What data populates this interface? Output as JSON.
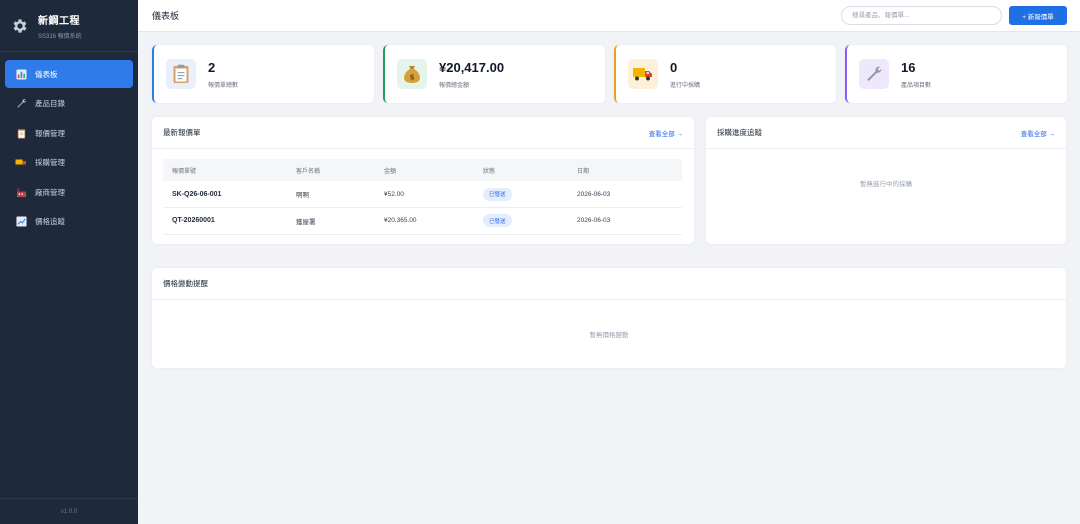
{
  "brand": {
    "title": "新鋼工程",
    "subtitle": "SS316 報價系統",
    "version": "v1.0.0"
  },
  "nav": [
    {
      "label": "儀表板",
      "icon": "chart-icon",
      "active": true
    },
    {
      "label": "產品目錄",
      "icon": "wrench-icon",
      "active": false
    },
    {
      "label": "報價管理",
      "icon": "clipboard-icon",
      "active": false
    },
    {
      "label": "採購管理",
      "icon": "truck-icon",
      "active": false
    },
    {
      "label": "廠商管理",
      "icon": "factory-icon",
      "active": false
    },
    {
      "label": "價格追蹤",
      "icon": "trend-icon",
      "active": false
    }
  ],
  "topbar": {
    "title": "儀表板",
    "search_placeholder": "搜尋產品、報價單...",
    "new_button": "+ 新報價單"
  },
  "stats": [
    {
      "value": "2",
      "label": "報價單總數",
      "accent": "#2f7bea",
      "icon": "clipboard-icon"
    },
    {
      "value": "¥20,417.00",
      "label": "報價總金額",
      "accent": "#22a05b",
      "icon": "money-bag-icon"
    },
    {
      "value": "0",
      "label": "進行中採購",
      "accent": "#f0a020",
      "icon": "truck-icon"
    },
    {
      "value": "16",
      "label": "產品項目數",
      "accent": "#8b5cf6",
      "icon": "wrench-icon"
    }
  ],
  "quotes": {
    "title": "最新報價單",
    "view_all": "查看全部 →",
    "columns": [
      "報價單號",
      "客戶名稱",
      "金額",
      "狀態",
      "日期"
    ],
    "rows": [
      {
        "code": "SK-Q26-06-001",
        "customer": "啊啊",
        "amount": "¥52.00",
        "status": "已發送",
        "date": "2026-06-03"
      },
      {
        "code": "QT-20260001",
        "customer": "獲屋署",
        "amount": "¥20,365.00",
        "status": "已發送",
        "date": "2026-06-03"
      }
    ]
  },
  "purchase": {
    "title": "採購進度追蹤",
    "view_all": "查看全部 →",
    "empty": "暫無進行中的採購"
  },
  "price_alerts": {
    "title": "價格變動提醒",
    "empty": "暫無價格變動"
  }
}
